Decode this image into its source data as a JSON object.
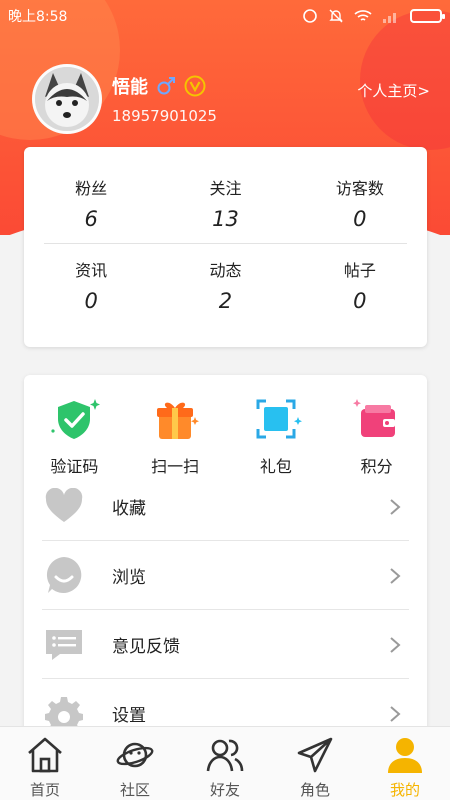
{
  "status_bar": {
    "time": "晚上8:58"
  },
  "profile": {
    "name": "悟能",
    "phone": "18957901025",
    "homepage_link": "个人主页>"
  },
  "stats": [
    {
      "label": "粉丝",
      "value": "6"
    },
    {
      "label": "关注",
      "value": "13"
    },
    {
      "label": "访客数",
      "value": "0"
    },
    {
      "label": "资讯",
      "value": "0"
    },
    {
      "label": "动态",
      "value": "2"
    },
    {
      "label": "帖子",
      "value": "0"
    }
  ],
  "quick_actions": [
    {
      "label": "验证码",
      "icon": "shield-check-icon"
    },
    {
      "label": "扫一扫",
      "icon": "gift-icon"
    },
    {
      "label": "礼包",
      "icon": "scan-icon"
    },
    {
      "label": "积分",
      "icon": "wallet-icon"
    }
  ],
  "menu": [
    {
      "label": "收藏",
      "icon": "heart-icon"
    },
    {
      "label": "浏览",
      "icon": "smile-icon"
    },
    {
      "label": "意见反馈",
      "icon": "feedback-icon"
    },
    {
      "label": "设置",
      "icon": "gear-icon"
    }
  ],
  "tabs": [
    {
      "label": "首页",
      "icon": "home-icon",
      "active": false
    },
    {
      "label": "社区",
      "icon": "planet-icon",
      "active": false
    },
    {
      "label": "好友",
      "icon": "friends-icon",
      "active": false
    },
    {
      "label": "角色",
      "icon": "paper-plane-icon",
      "active": false
    },
    {
      "label": "我的",
      "icon": "user-icon",
      "active": true
    }
  ],
  "colors": {
    "brand": "#fb5533",
    "accent": "#f5b400",
    "male_badge": "#6fa8ff",
    "vip": "#f5c400"
  }
}
